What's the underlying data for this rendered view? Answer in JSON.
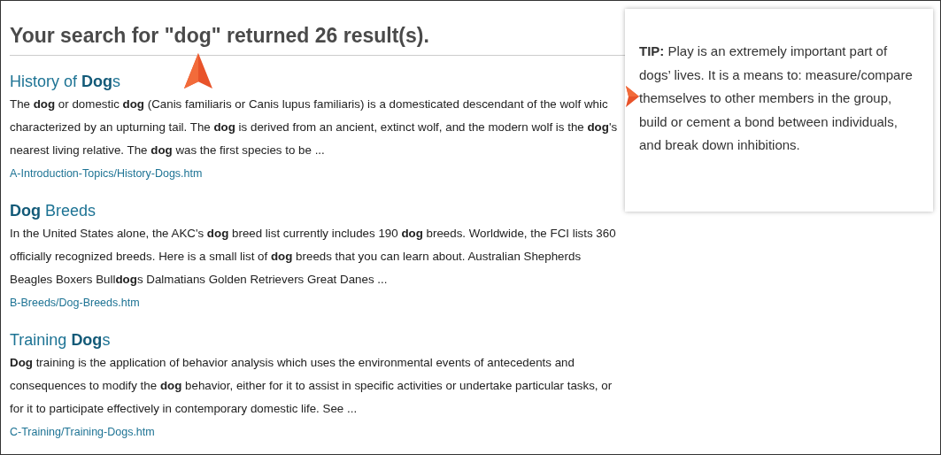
{
  "heading": "Your search for \"dog\" returned 26 result(s).",
  "results": [
    {
      "title": "History of **Dog**s",
      "snippet": "The **dog** or domestic **dog** (Canis familiaris or Canis lupus familiaris) is a domesticated descendant of the wolf whic characterized by an upturning tail. The **dog** is derived from an ancient, extinct wolf, and the modern wolf is the **dog**'s nearest living relative. The **dog** was the first species to be ...",
      "url": "A-Introduction-Topics/History-Dogs.htm"
    },
    {
      "title": "**Dog** Breeds",
      "snippet": "In the United States alone, the AKC's **dog** breed list currently includes 190 **dog** breeds. Worldwide, the FCI lists 360 officially recognized breeds. Here is a small list of **dog** breeds that you can learn about. Australian Shepherds Beagles Boxers Bull**dog**s Dalmatians Golden Retrievers Great Danes ...",
      "url": "B-Breeds/Dog-Breeds.htm"
    },
    {
      "title": "Training **Dog**s",
      "snippet": "**Dog** training is the application of behavior analysis which uses the environmental events of antecedents and consequences to modify the **dog** behavior, either for it to assist in specific activities or undertake particular tasks, or for it to participate effectively in contemporary domestic life. See ...",
      "url": "C-Training/Training-Dogs.htm"
    }
  ],
  "tip": "**TIP:** Play is an extremely important part of dogs’ lives. It is a means to: measure/compare themselves to other members in the group, build or cement a bond between individuals, and break down inhibitions."
}
